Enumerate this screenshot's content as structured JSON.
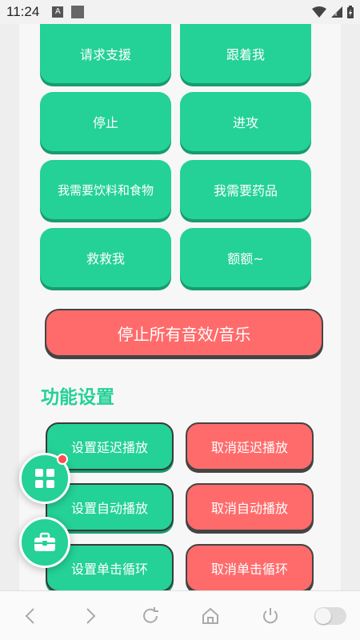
{
  "status": {
    "time": "11:24",
    "a_badge": "A"
  },
  "quick_buttons": [
    {
      "label": "请求支援"
    },
    {
      "label": "跟着我"
    },
    {
      "label": "停止"
    },
    {
      "label": "进攻"
    },
    {
      "label": "我需要饮料和食物"
    },
    {
      "label": "我需要药品"
    },
    {
      "label": "救救我"
    },
    {
      "label": "额额~"
    }
  ],
  "stop_all": {
    "label": "停止所有音效/音乐"
  },
  "settings": {
    "title": "功能设置",
    "set_delay": "设置延迟播放",
    "cancel_delay": "取消延迟播放",
    "set_auto": "设置自动播放",
    "cancel_auto": "取消自动播放",
    "set_loop": "设置单击循环",
    "cancel_loop": "取消单击循环"
  },
  "colors": {
    "accent": "#24d197",
    "danger": "#ff6b6b",
    "dot": "#ff4d4f"
  },
  "icons": {
    "fab_top": "grid-icon",
    "fab_bottom": "toolbox-icon",
    "nav": [
      "back-icon",
      "forward-icon",
      "refresh-icon",
      "home-icon",
      "power-icon",
      "toggle-switch"
    ]
  }
}
